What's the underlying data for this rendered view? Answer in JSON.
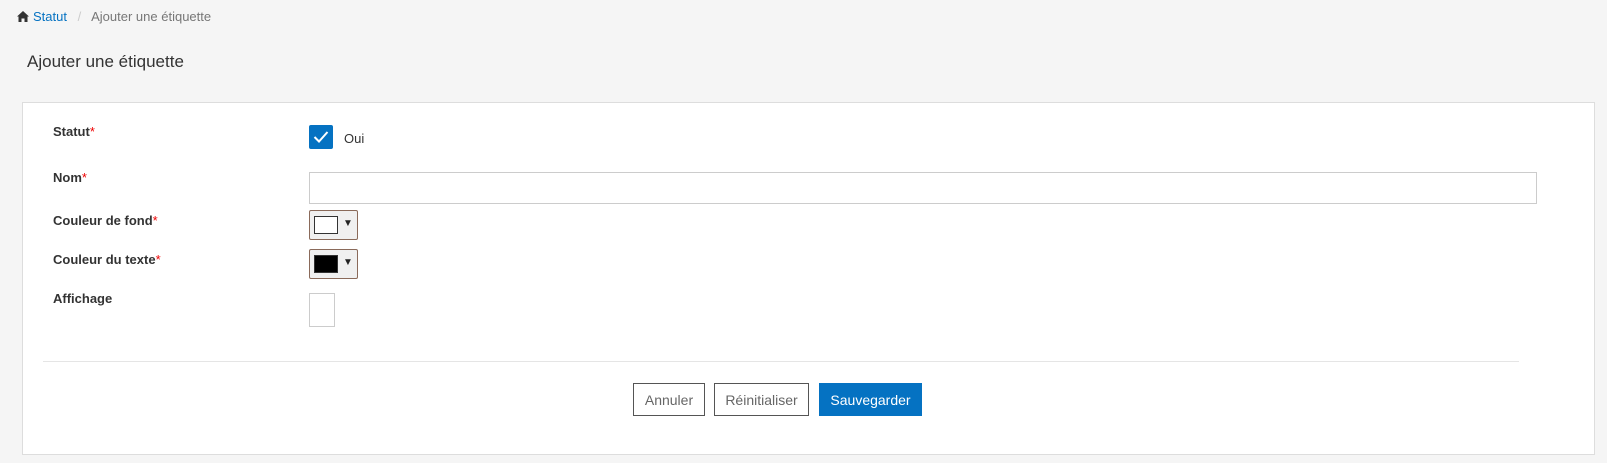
{
  "breadcrumb": {
    "home_label": "Statut",
    "separator": "/",
    "current": "Ajouter une étiquette"
  },
  "page": {
    "title": "Ajouter une étiquette"
  },
  "form": {
    "required_marker": "*",
    "status": {
      "label": "Statut",
      "checked": true,
      "option_label": "Oui"
    },
    "name": {
      "label": "Nom",
      "value": "",
      "placeholder": ""
    },
    "background_color": {
      "label": "Couleur de fond",
      "value": "#ffffff"
    },
    "text_color": {
      "label": "Couleur du texte",
      "value": "#000000"
    },
    "display": {
      "label": "Affichage"
    }
  },
  "actions": {
    "cancel": "Annuler",
    "reset": "Réinitialiser",
    "save": "Sauvegarder"
  },
  "colors": {
    "accent": "#0572c2",
    "required": "#ee0000"
  },
  "icons": {
    "home": "home-icon",
    "check": "check-icon",
    "caret": "caret-down-icon"
  }
}
